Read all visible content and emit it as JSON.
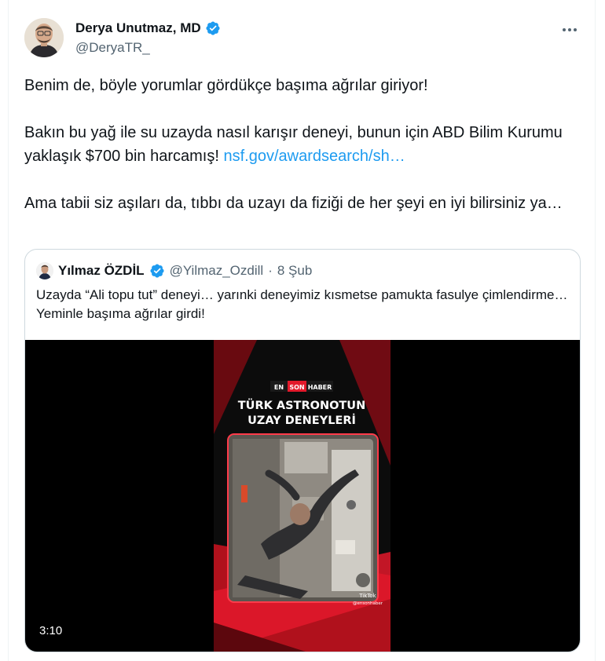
{
  "tweet": {
    "author_name": "Derya Unutmaz, MD",
    "author_handle": "@DeryaTR_",
    "paragraph1": "Benim de, böyle yorumlar gördükçe başıma ağrılar giriyor!",
    "paragraph2": "Bakın bu yağ ile su uzayda nasıl karışır deneyi, bunun için ABD Bilim Kurumu yaklaşık $700 bin harcamış! ",
    "link_text": "nsf.gov/awardsearch/sh…",
    "paragraph3": "Ama tabii siz aşıları da, tıbbı da uzayı da fiziği de her şeyi en iyi bilirsiniz ya…"
  },
  "quote": {
    "author_name": "Yılmaz ÖZDİL",
    "author_handle": "@Yilmaz_Ozdill",
    "separator": "·",
    "date": "8 Şub",
    "text": "Uzayda “Ali topu tut” deneyi… yarınki deneyimiz kısmetse pamukta fasulye çimlendirme… Yeminle başıma ağrılar girdi!",
    "video": {
      "duration": "3:10",
      "badge_en": "EN",
      "badge_son": "SON",
      "badge_haber": "HABER",
      "headline_line1": "TÜRK ASTRONOTUN",
      "headline_line2": "UZAY DENEYLERİ",
      "tiktok_label": "TikTok",
      "tiktok_handle": "@ensonhaber"
    }
  },
  "icons": {
    "verified": "verified-badge-icon",
    "more": "more-options-icon",
    "tiktok": "tiktok-icon"
  },
  "colors": {
    "link": "#1d9bf0",
    "verified": "#1d9bf0",
    "secondary_text": "#536471",
    "border": "#cfd9de",
    "video_accent": "#e3192b"
  }
}
